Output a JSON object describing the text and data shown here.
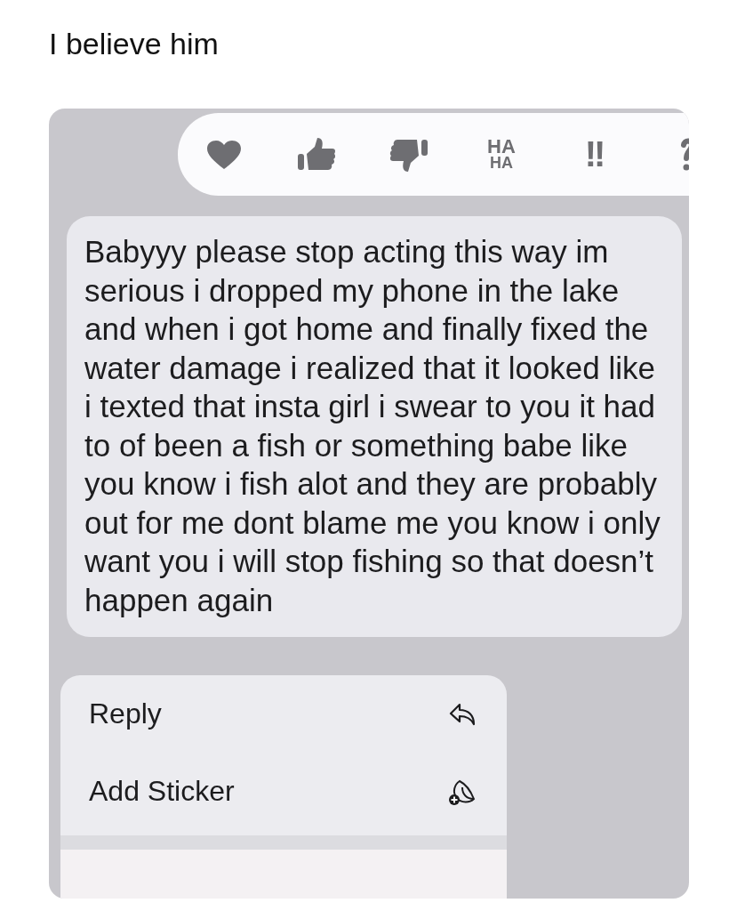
{
  "post": {
    "caption": "I believe him"
  },
  "reactions": [
    {
      "kind": "heart"
    },
    {
      "kind": "thumbs-up"
    },
    {
      "kind": "thumbs-down"
    },
    {
      "kind": "haha",
      "lines": [
        "HA",
        "HA"
      ]
    },
    {
      "kind": "emphasis",
      "text": "!!"
    },
    {
      "kind": "question"
    }
  ],
  "message": {
    "text": "Babyyy please stop acting this way im serious i dropped my phone in the lake and when i got home and finally fixed the water damage i realized that it looked like i texted that insta girl i swear to you it had to of been a fish or something babe like you know i fish alot and they are probably out for me dont blame me you know i only want you i will stop fishing so that doesn’t happen again"
  },
  "menu": [
    {
      "kind": "reply",
      "label": "Reply"
    },
    {
      "kind": "sticker",
      "label": "Add Sticker"
    }
  ]
}
